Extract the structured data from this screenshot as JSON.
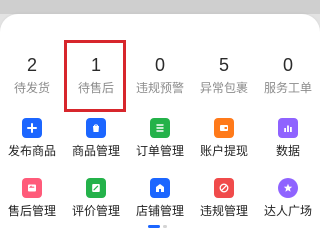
{
  "stats": [
    {
      "value": "2",
      "label": "待发货"
    },
    {
      "value": "1",
      "label": "待售后"
    },
    {
      "value": "0",
      "label": "违规预警"
    },
    {
      "value": "5",
      "label": "异常包裹"
    },
    {
      "value": "0",
      "label": "服务工单"
    }
  ],
  "icons": {
    "publish": "publish-product-icon",
    "product": "shopping-bag-icon",
    "order": "order-list-icon",
    "account": "wallet-icon",
    "data": "bar-chart-icon",
    "aftersale": "return-icon",
    "review": "edit-icon",
    "store": "store-icon",
    "violation": "warning-icon",
    "talent": "star-icon"
  },
  "menu": {
    "row1": [
      {
        "label": "发布商品"
      },
      {
        "label": "商品管理"
      },
      {
        "label": "订单管理"
      },
      {
        "label": "账户提现"
      },
      {
        "label": "数据"
      }
    ],
    "row2": [
      {
        "label": "售后管理"
      },
      {
        "label": "评价管理"
      },
      {
        "label": "店铺管理"
      },
      {
        "label": "违规管理"
      },
      {
        "label": "达人广场"
      }
    ]
  },
  "colors": {
    "blue": "#1c66ff",
    "green": "#24b24a",
    "orange": "#ff7a1a",
    "purple": "#8f63ff",
    "pink": "#ff5b7a",
    "red": "#f04b4b",
    "highlight": "#d7262c"
  },
  "pager": {
    "active_index": 0,
    "count": 2
  }
}
